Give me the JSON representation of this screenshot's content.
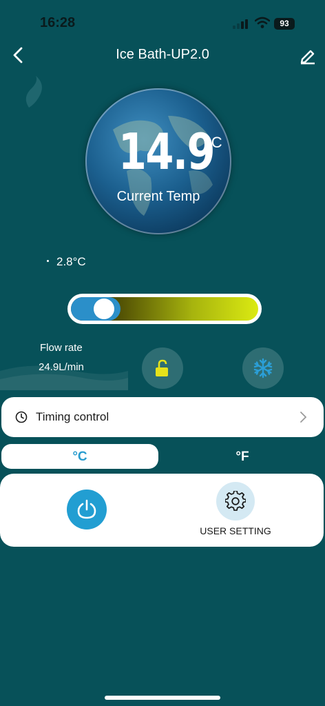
{
  "status_bar": {
    "time": "16:28",
    "battery": "93"
  },
  "header": {
    "title": "Ice Bath-UP2.0"
  },
  "main": {
    "current_temp_value": "14.9",
    "current_temp_unit": "°C",
    "current_temp_label": "Current Temp",
    "set_temp": "2.8°C",
    "slider_level": 0.13,
    "flow_rate_label": "Flow rate",
    "flow_rate_value": "24.9L/min"
  },
  "timing": {
    "label": "Timing control"
  },
  "units": {
    "celsius": "°C",
    "fahrenheit": "°F",
    "selected": "°C"
  },
  "card": {
    "user_setting_label": "USER SETTING"
  },
  "colors": {
    "background": "#075159",
    "accent_blue": "#229ed2",
    "lock_yellow": "#e6e21b",
    "snow_blue": "#2b9fd8"
  },
  "icons": [
    "back-icon",
    "edit-icon",
    "lock-icon",
    "snowflake-icon",
    "clock-icon",
    "chevron-right-icon",
    "power-icon",
    "gear-icon"
  ]
}
